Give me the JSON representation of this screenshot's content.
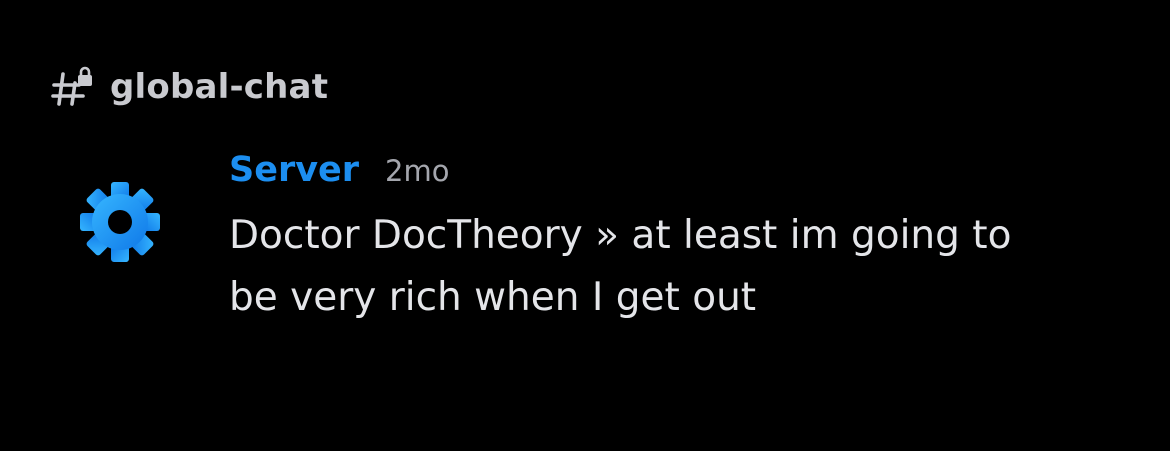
{
  "channel": {
    "name": "global-chat",
    "icon": "locked-hash-icon"
  },
  "message": {
    "author": "Server",
    "author_color": "#1c8ef0",
    "timestamp": "2mo",
    "avatar_icon": "gear-icon",
    "content": "Doctor DocTheory » at least im going to be very rich when I get out"
  }
}
